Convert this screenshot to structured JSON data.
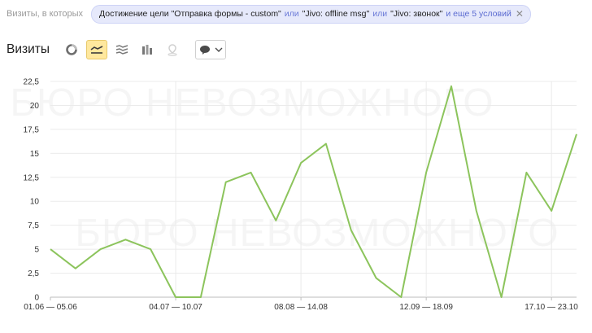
{
  "filter": {
    "prefix": "Визиты, в которых",
    "condition_1": "Достижение цели \"Отправка формы - custom\"",
    "or_1": "или",
    "condition_2": "\"Jivo: offline msg\"",
    "or_2": "или",
    "condition_3": "\"Jivo: звонок\"",
    "more": "и еще 5 условий",
    "close_icon": "close-icon"
  },
  "header": {
    "title": "Визиты",
    "tools": [
      {
        "name": "pie-chart-icon",
        "active": false
      },
      {
        "name": "line-chart-icon",
        "active": true
      },
      {
        "name": "area-chart-icon",
        "active": false
      },
      {
        "name": "bar-chart-icon",
        "active": false
      },
      {
        "name": "map-icon",
        "active": false,
        "disabled": true
      },
      {
        "name": "comment-icon",
        "active": false
      }
    ]
  },
  "colors": {
    "series": "#8cc45c",
    "accent_pill_bg": "#e6e9fb",
    "active_tool_bg": "#ffe89e"
  },
  "watermark": "БЮРО НЕВОЗМОЖНОГО",
  "chart_data": {
    "type": "line",
    "ylim": [
      0,
      22.5
    ],
    "y_ticks": [
      "0",
      "2,5",
      "5",
      "7,5",
      "10",
      "12,5",
      "15",
      "17,5",
      "20",
      "22,5"
    ],
    "x_tick_labels": [
      {
        "index": 0,
        "label": "01.06 — 05.06"
      },
      {
        "index": 5,
        "label": "04.07 — 10.07"
      },
      {
        "index": 10,
        "label": "08.08 — 14.08"
      },
      {
        "index": 15,
        "label": "12.09 — 18.09"
      },
      {
        "index": 20,
        "label": "17.10 — 23.10"
      }
    ],
    "grid": true,
    "series": [
      {
        "values": [
          5,
          3,
          5,
          6,
          5,
          0,
          0,
          12,
          13,
          8,
          14,
          16,
          7,
          2,
          0,
          13,
          22,
          9,
          0,
          13,
          9,
          17
        ]
      }
    ]
  }
}
